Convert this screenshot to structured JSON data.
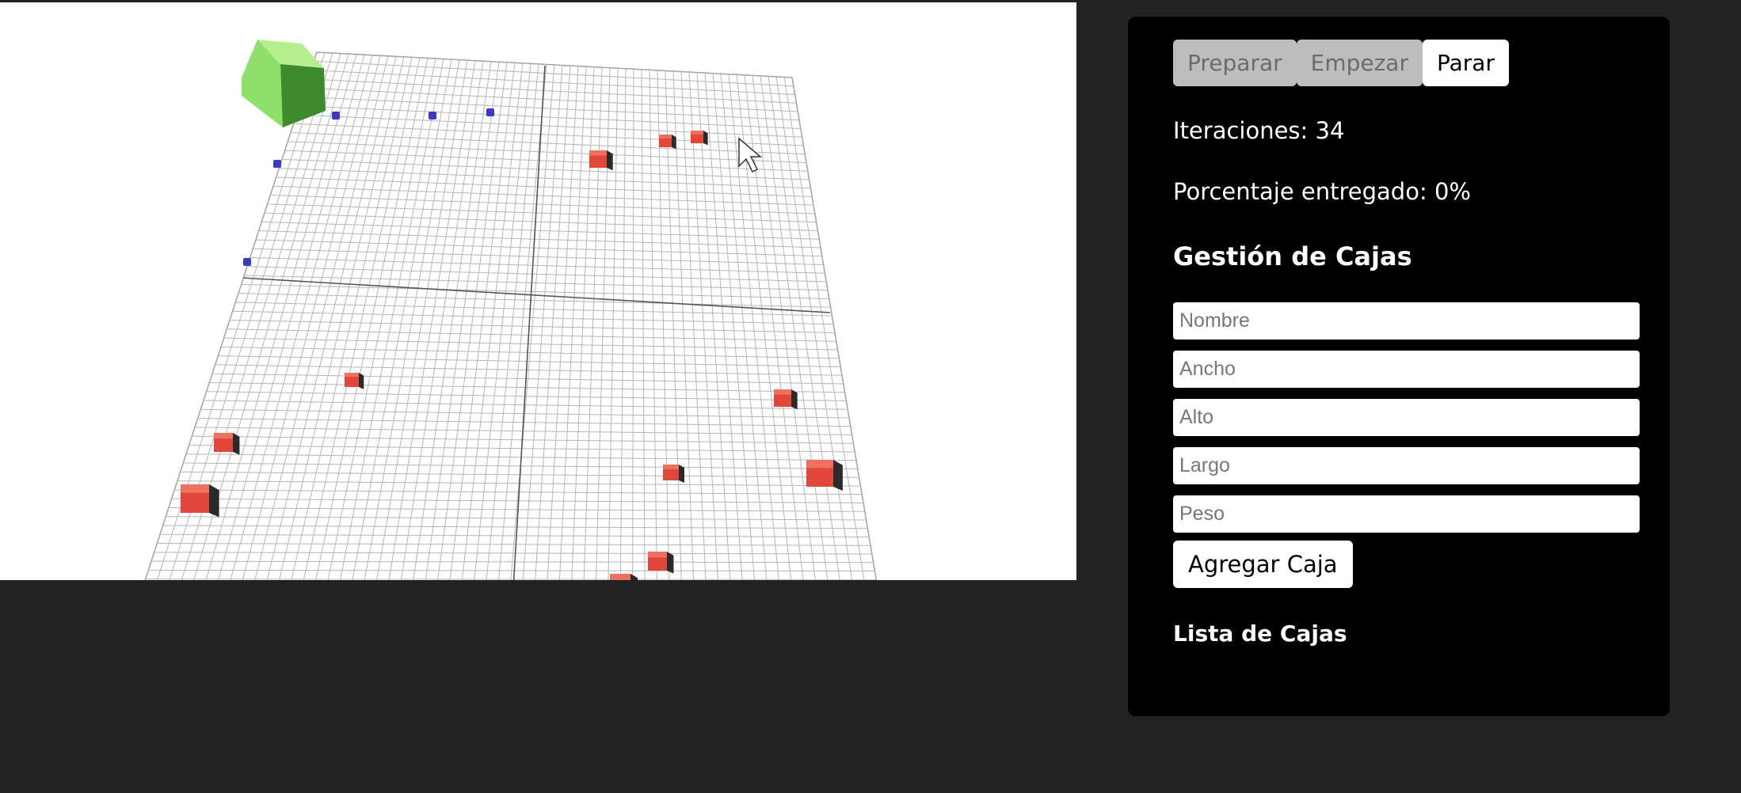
{
  "scene": {
    "agents_color": "#3a3ac8",
    "boxes_color": "#e0463a",
    "target_color": "#8ee06a",
    "grid_color": "#9a9a9a"
  },
  "controls": {
    "prepare_label": "Preparar",
    "start_label": "Empezar",
    "stop_label": "Parar"
  },
  "stats": {
    "iterations_label": "Iteraciones: 34",
    "delivered_label": "Porcentaje entregado: 0%"
  },
  "box_management": {
    "title": "Gestión de Cajas",
    "fields": {
      "name_placeholder": "Nombre",
      "width_placeholder": "Ancho",
      "height_placeholder": "Alto",
      "length_placeholder": "Largo",
      "weight_placeholder": "Peso"
    },
    "add_label": "Agregar Caja",
    "list_title": "Lista de Cajas"
  }
}
